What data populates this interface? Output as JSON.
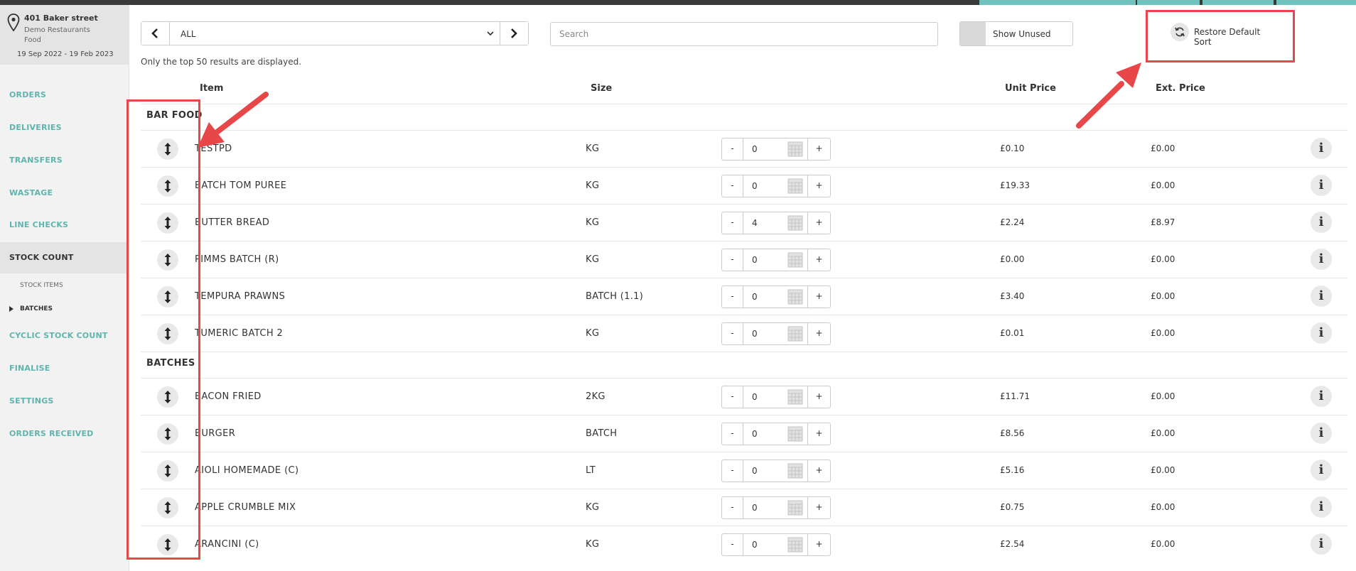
{
  "location": {
    "street": "401 Baker street",
    "organisation": "Demo Restaurants",
    "department": "Food",
    "date_range": "19 Sep 2022 - 19 Feb 2023"
  },
  "nav": {
    "orders": "ORDERS",
    "deliveries": "DELIVERIES",
    "transfers": "TRANSFERS",
    "wastage": "WASTAGE",
    "line_checks": "LINE CHECKS",
    "stock_count": "STOCK COUNT",
    "stock_items": "STOCK ITEMS",
    "batches": "BATCHES",
    "cyclic_stock_count": "CYCLIC STOCK COUNT",
    "finalise": "FINALISE",
    "settings": "SETTINGS",
    "orders_received": "ORDERS RECEIVED"
  },
  "toolbar": {
    "filter_selected": "ALL",
    "search_placeholder": "Search",
    "show_unused_label": "Show Unused",
    "restore_label": "Restore Default Sort",
    "notice": "Only the top 50 results are displayed."
  },
  "table": {
    "headers": {
      "item": "Item",
      "size": "Size",
      "unit_price": "Unit Price",
      "ext_price": "Ext. Price"
    },
    "qty_minus": "-",
    "qty_plus": "+",
    "info_glyph": "i",
    "groups": [
      {
        "name": "BAR FOOD",
        "rows": [
          {
            "item": "TESTPD",
            "size": "KG",
            "qty": "0",
            "unit_price": "£0.10",
            "ext_price": "£0.00"
          },
          {
            "item": "BATCH TOM PUREE",
            "size": "KG",
            "qty": "0",
            "unit_price": "£19.33",
            "ext_price": "£0.00"
          },
          {
            "item": "BUTTER BREAD",
            "size": "KG",
            "qty": "4",
            "unit_price": "£2.24",
            "ext_price": "£8.97"
          },
          {
            "item": "PIMMS BATCH (R)",
            "size": "KG",
            "qty": "0",
            "unit_price": "£0.00",
            "ext_price": "£0.00"
          },
          {
            "item": "TEMPURA PRAWNS",
            "size": "BATCH (1.1)",
            "qty": "0",
            "unit_price": "£3.40",
            "ext_price": "£0.00"
          },
          {
            "item": "TUMERIC BATCH 2",
            "size": "KG",
            "qty": "0",
            "unit_price": "£0.01",
            "ext_price": "£0.00"
          }
        ]
      },
      {
        "name": "BATCHES",
        "rows": [
          {
            "item": "BACON FRIED",
            "size": "2KG",
            "qty": "0",
            "unit_price": "£11.71",
            "ext_price": "£0.00"
          },
          {
            "item": "BURGER",
            "size": "BATCH",
            "qty": "0",
            "unit_price": "£8.56",
            "ext_price": "£0.00"
          },
          {
            "item": "AIOLI HOMEMADE (C)",
            "size": "LT",
            "qty": "0",
            "unit_price": "£5.16",
            "ext_price": "£0.00"
          },
          {
            "item": "APPLE CRUMBLE MIX",
            "size": "KG",
            "qty": "0",
            "unit_price": "£0.75",
            "ext_price": "£0.00"
          },
          {
            "item": "ARANCINI (C)",
            "size": "KG",
            "qty": "0",
            "unit_price": "£2.54",
            "ext_price": "£0.00"
          }
        ]
      }
    ]
  },
  "colors": {
    "accent": "#5fb5ae",
    "annotation": "#e8474a"
  }
}
